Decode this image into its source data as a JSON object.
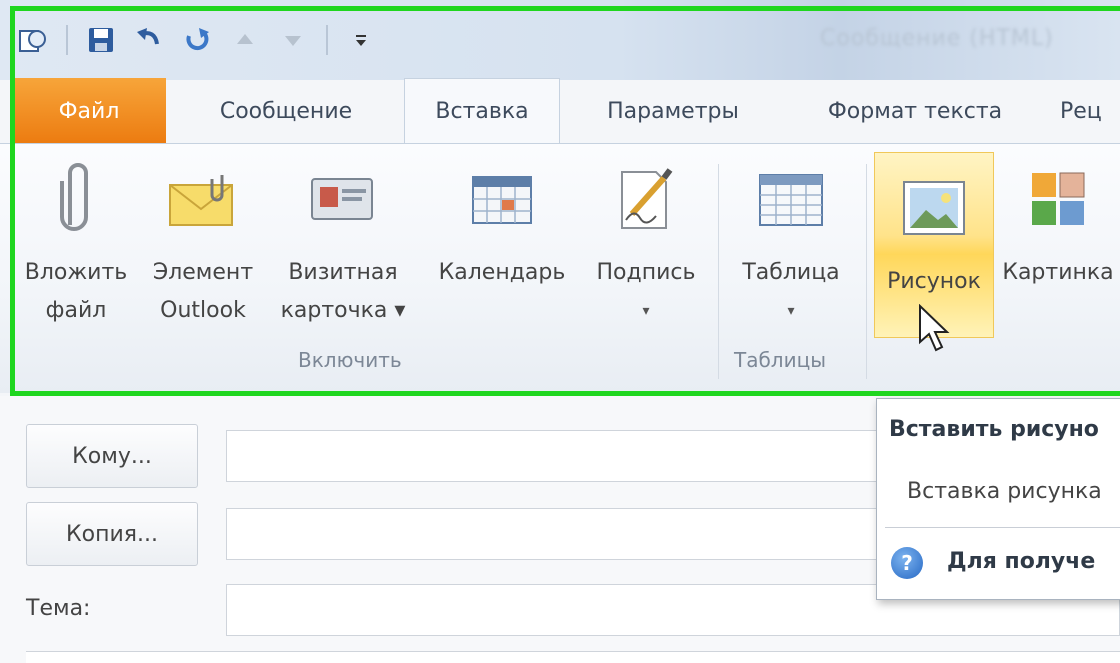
{
  "window": {
    "title": "Сообщение (HTML)"
  },
  "quick_access": {
    "items": [
      {
        "name": "outlook-icon"
      },
      {
        "name": "save-icon"
      },
      {
        "name": "undo-icon"
      },
      {
        "name": "redo-icon"
      },
      {
        "name": "up-arrow-icon"
      },
      {
        "name": "down-arrow-icon"
      },
      {
        "name": "customize-icon"
      }
    ]
  },
  "tabs": [
    {
      "label": "Файл"
    },
    {
      "label": "Сообщение"
    },
    {
      "label": "Вставка"
    },
    {
      "label": "Параметры"
    },
    {
      "label": "Формат текста"
    },
    {
      "label": "Рец"
    }
  ],
  "ribbon": {
    "buttons": [
      {
        "line1": "Вложить",
        "line2": "файл",
        "icon": "paperclip-icon"
      },
      {
        "line1": "Элемент",
        "line2": "Outlook",
        "icon": "envelope-icon"
      },
      {
        "line1": "Визитная",
        "line2": "карточка ▾",
        "icon": "business-card-icon"
      },
      {
        "line1": "Календарь",
        "line2": "",
        "icon": "calendar-icon"
      },
      {
        "line1": "Подпись",
        "line2": "▾",
        "icon": "signature-icon"
      },
      {
        "line1": "Таблица",
        "line2": "▾",
        "icon": "table-icon"
      },
      {
        "line1": "Рисунок",
        "line2": "",
        "icon": "picture-icon"
      },
      {
        "line1": "Картинка",
        "line2": "",
        "icon": "clipart-icon"
      }
    ],
    "groups": {
      "include": "Включить",
      "tables": "Таблицы"
    }
  },
  "compose": {
    "to_button": "Кому...",
    "cc_button": "Копия...",
    "subject_label": "Тема:",
    "to_value": "",
    "cc_value": "",
    "subject_value": ""
  },
  "tooltip": {
    "title": "Вставить рисуно",
    "description": "Вставка рисунка",
    "help": "Для получе"
  },
  "colors": {
    "file_tab": "#ec7b10",
    "highlight_border": "#1fd61f",
    "hover_button": "#ffd75a"
  }
}
